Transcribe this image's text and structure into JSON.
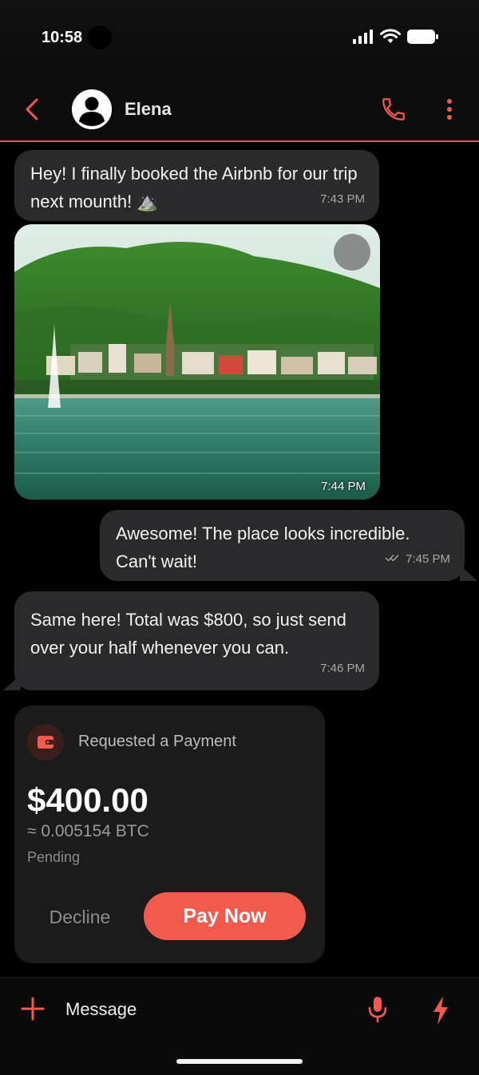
{
  "status_bar": {
    "time": "10:58",
    "icons": [
      "signal-icon",
      "wifi-icon",
      "battery-icon"
    ]
  },
  "header": {
    "contact_name": "Elena",
    "icons": [
      "back-icon",
      "user-avatar-icon",
      "phone-icon",
      "more-vertical-icon"
    ]
  },
  "messages": [
    {
      "direction": "incoming",
      "text": "Hey! I finally booked the Airbnb for our trip next mounth! ⛰️",
      "time": "7:43 PM"
    },
    {
      "direction": "incoming",
      "type": "image",
      "alt": "Lakeside town with mountains",
      "time": "7:44 PM"
    },
    {
      "direction": "outgoing",
      "text": "Awesome! The place looks incredible. Can't wait!",
      "time": "7:45 PM",
      "status": "read"
    },
    {
      "direction": "incoming",
      "text": "Same here! Total was $800, so just send over your half whenever you can.",
      "time": "7:46 PM"
    }
  ],
  "payment": {
    "title": "Requested a Payment",
    "amount": "$400.00",
    "btc": "≈ 0.005154 BTC",
    "status": "Pending",
    "decline_label": "Decline",
    "pay_label": "Pay Now"
  },
  "composer": {
    "placeholder": "Message",
    "icons": [
      "plus-icon",
      "mic-icon",
      "bolt-icon"
    ]
  },
  "colors": {
    "accent": "#f15a4d",
    "bubble": "#2a2a2c",
    "card": "#1b1b1c",
    "background": "#000000"
  }
}
